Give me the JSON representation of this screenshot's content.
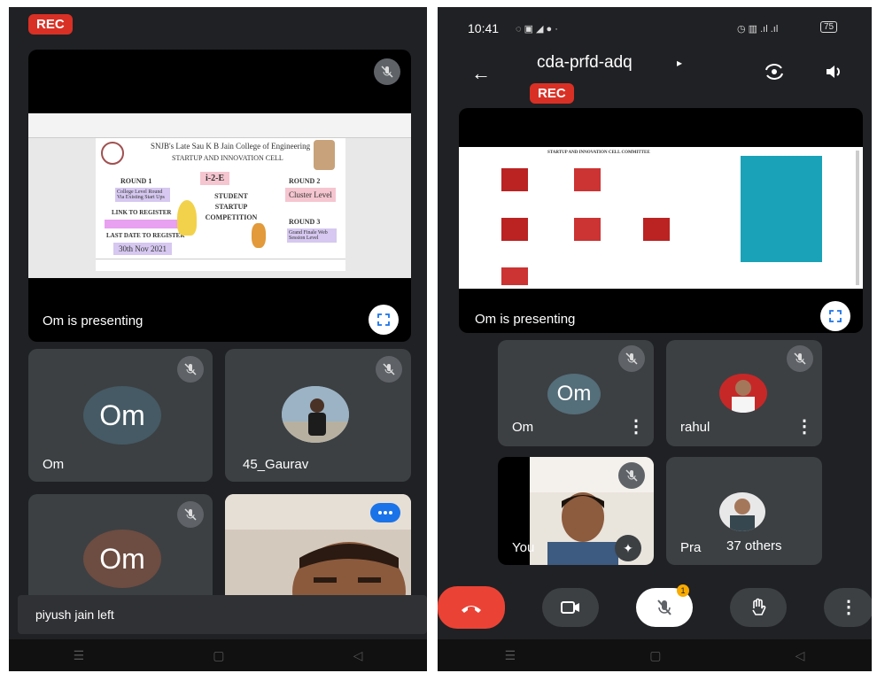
{
  "left": {
    "rec_label": "REC",
    "presenter_text": "Om is presenting",
    "slide": {
      "college_line": "SNJB's Late Sau K B Jain College of Engineering",
      "cell_line": "STARTUP AND INNOVATION CELL",
      "logo_text": "i-2-E",
      "round1": "ROUND 1",
      "round1_desc": "College Level Round Via Existing Start Ups",
      "link_label": "LINK TO REGISTER",
      "last_date_label": "LAST DATE TO REGISTER",
      "last_date": "30th Nov 2021",
      "center_title": "STUDENT STARTUP COMPETITION",
      "round2": "ROUND 2",
      "round2_desc": "Cluster Level",
      "round3": "ROUND 3",
      "round3_desc": "Grand Finale Web Session Level"
    },
    "participants": [
      {
        "initials": "Om",
        "name": "Om"
      },
      {
        "initials": "",
        "name": "45_Gaurav"
      },
      {
        "initials": "Om",
        "name": ""
      },
      {
        "initials": "",
        "name": ""
      }
    ],
    "toast": "piyush jain left"
  },
  "right": {
    "status_time": "10:41",
    "status_battery": "75",
    "meeting_code": "cda-prfd-adq",
    "rec_label": "REC",
    "presenter_text": "Om is presenting",
    "slide_heading": "STARTUP AND INNOVATION CELL COMMITTEE",
    "participants": [
      {
        "initials": "Om",
        "name": "Om"
      },
      {
        "initials": "",
        "name": "rahul"
      },
      {
        "initials": "",
        "name": "You"
      },
      {
        "initials": "",
        "name": "Pra"
      }
    ],
    "others_label": "37 others",
    "badge_count": "1"
  },
  "colors": {
    "background": "#202124",
    "tile": "#3c4043",
    "rec": "#d93025",
    "end_call": "#ea4335",
    "om_avatar_left": "#455a64",
    "om_avatar_brown": "#6d4c41",
    "om_avatar_right": "#546e7a"
  }
}
